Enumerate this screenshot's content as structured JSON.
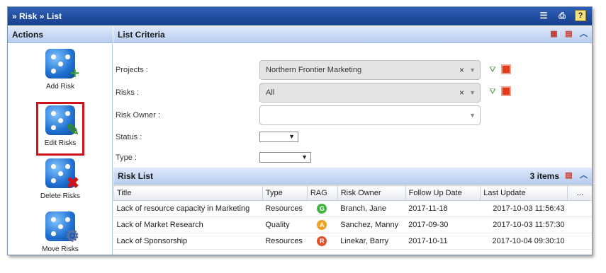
{
  "window": {
    "title": "» Risk » List"
  },
  "actions": {
    "header": "Actions",
    "items": [
      {
        "label": "Add Risk",
        "badge": "+",
        "badge_color": "#3aa33a"
      },
      {
        "label": "Edit Risks",
        "badge": "✎",
        "badge_color": "#2e8b2e"
      },
      {
        "label": "Delete Risks",
        "badge": "✖",
        "badge_color": "#d0121a"
      },
      {
        "label": "Move Risks",
        "badge": "⚙",
        "badge_color": "#5b6fa0"
      }
    ],
    "selected_index": 1
  },
  "criteria": {
    "header": "List Criteria",
    "projects": {
      "label": "Projects :",
      "value": "Northern Frontier Marketing"
    },
    "risks": {
      "label": "Risks :",
      "value": "All"
    },
    "risk_owner": {
      "label": "Risk Owner :",
      "value": ""
    },
    "status": {
      "label": "Status :",
      "value": ""
    },
    "type": {
      "label": "Type :",
      "value": ""
    }
  },
  "risk_list": {
    "header": "Risk List",
    "count": "3 items",
    "columns": [
      "Title",
      "Type",
      "RAG",
      "Risk Owner",
      "Follow Up Date",
      "Last Update",
      "..."
    ],
    "rows": [
      {
        "title": "Lack of resource capacity in Marketing",
        "type": "Resources",
        "rag": "G",
        "rag_color": "#3fb53f",
        "owner": "Branch, Jane",
        "follow_up": "2017-11-18",
        "last_update": "2017-10-03 11:56:43"
      },
      {
        "title": "Lack of Market Research",
        "type": "Quality",
        "rag": "A",
        "rag_color": "#f0a020",
        "owner": "Sanchez, Manny",
        "follow_up": "2017-09-30",
        "last_update": "2017-10-03 11:57:30"
      },
      {
        "title": "Lack of Sponsorship",
        "type": "Resources",
        "rag": "R",
        "rag_color": "#e2502a",
        "owner": "Linekar, Barry",
        "follow_up": "2017-10-11",
        "last_update": "2017-10-04 09:30:10"
      }
    ]
  }
}
